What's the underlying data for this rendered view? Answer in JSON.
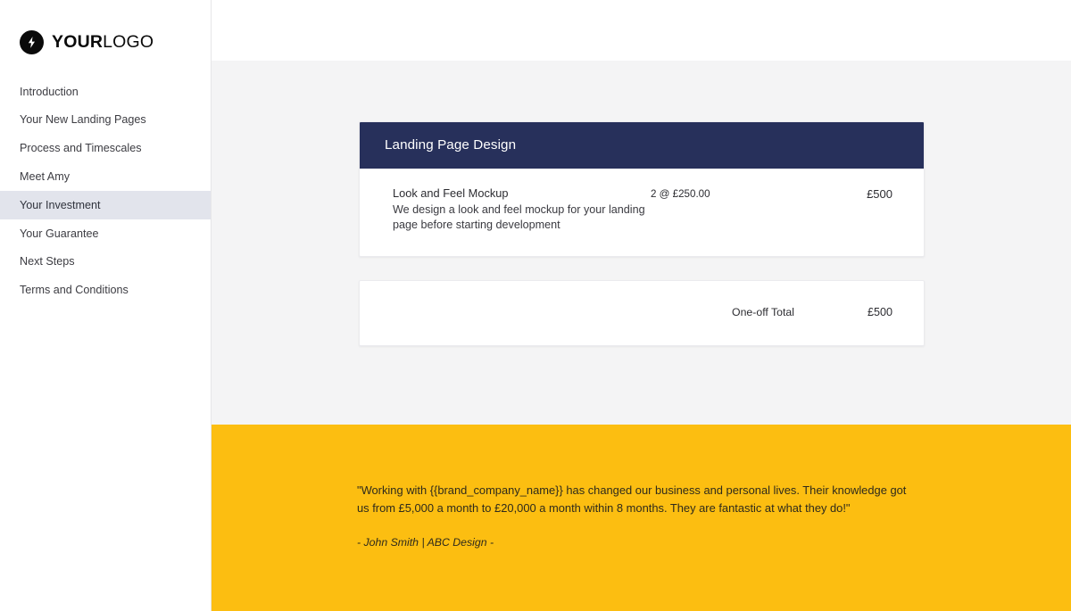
{
  "brand": {
    "logo_icon": "lightning-bolt-icon",
    "name_strong": "YOUR",
    "name_light": "LOGO"
  },
  "sidebar": {
    "items": [
      {
        "label": "Introduction",
        "active": false
      },
      {
        "label": "Your New Landing Pages",
        "active": false
      },
      {
        "label": "Process and Timescales",
        "active": false
      },
      {
        "label": "Meet Amy",
        "active": false
      },
      {
        "label": "Your Investment",
        "active": true
      },
      {
        "label": "Your Guarantee",
        "active": false
      },
      {
        "label": "Next Steps",
        "active": false
      },
      {
        "label": "Terms and Conditions",
        "active": false
      }
    ]
  },
  "pricing_card": {
    "header_title": "Landing Page Design",
    "line_items": [
      {
        "title": "Look and Feel Mockup",
        "description": "We design a look and feel mockup for your landing page before starting development",
        "quantity": "2 @ £250.00",
        "amount": "£500"
      }
    ]
  },
  "totals": {
    "label": "One-off Total",
    "amount": "£500"
  },
  "testimonial": {
    "quote": "\"Working with {{brand_company_name}} has changed our business and personal lives. Their knowledge got us from £5,000 a month to £20,000 a month within 8 months. They are fantastic at what they do!\"",
    "attribution": "- John Smith | ABC Design -"
  },
  "colors": {
    "navy": "#27305B",
    "yellow": "#FCBE11",
    "page_background": "#F4F4F5",
    "sidebar_active": "#E2E4EC",
    "logo_black": "#0A0A0A"
  }
}
